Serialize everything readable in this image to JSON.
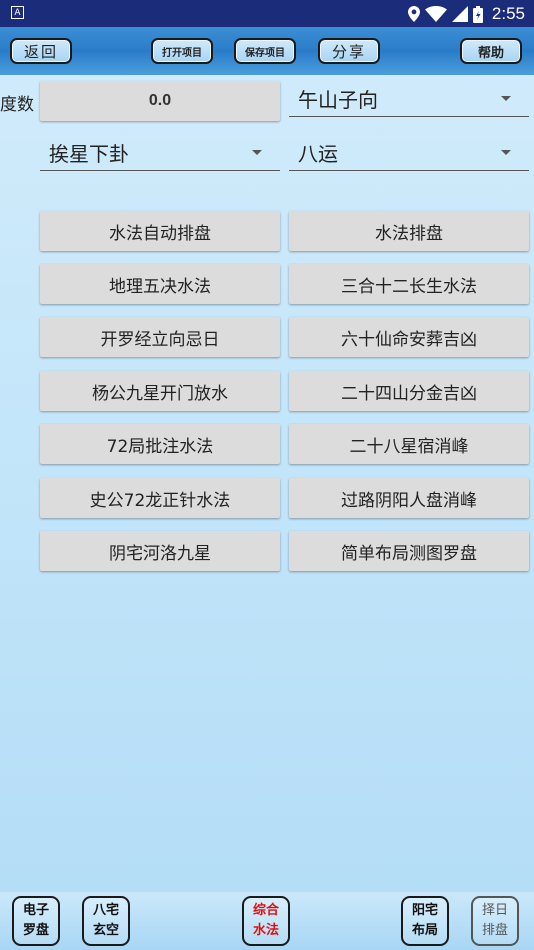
{
  "status_bar": {
    "app_icon_letter": "A",
    "time": "2:55"
  },
  "toolbar": {
    "back": "返回",
    "open_project": "打开项目",
    "save_project": "保存项目",
    "share": "分享",
    "help": "帮助"
  },
  "form": {
    "degree_label": "度数",
    "degree_value": "0.0",
    "direction_select": "午山子向",
    "trigram_select": "挨星下卦",
    "period_select": "八运"
  },
  "buttons": [
    [
      "水法自动排盘",
      "水法排盘"
    ],
    [
      "地理五决水法",
      "三合十二长生水法"
    ],
    [
      "开罗经立向忌日",
      "六十仙命安葬吉凶"
    ],
    [
      "杨公九星开门放水",
      "二十四山分金吉凶"
    ],
    [
      "72局批注水法",
      "二十八星宿消峰"
    ],
    [
      "史公72龙正针水法",
      "过路阴阳人盘消峰"
    ],
    [
      "阴宅河洛九星",
      "简单布局测图罗盘"
    ]
  ],
  "bottom_nav": [
    {
      "line1": "电子",
      "line2": "罗盘"
    },
    {
      "line1": "八宅",
      "line2": "玄空"
    },
    {
      "line1": "综合",
      "line2": "水法"
    },
    {
      "line1": "阳宅",
      "line2": "布局"
    },
    {
      "line1": "择日",
      "line2": "排盘"
    }
  ],
  "colors": {
    "status_bar": "#1b2c7a",
    "toolbar": "#2a7cc8",
    "active_tab": "#e01010"
  }
}
